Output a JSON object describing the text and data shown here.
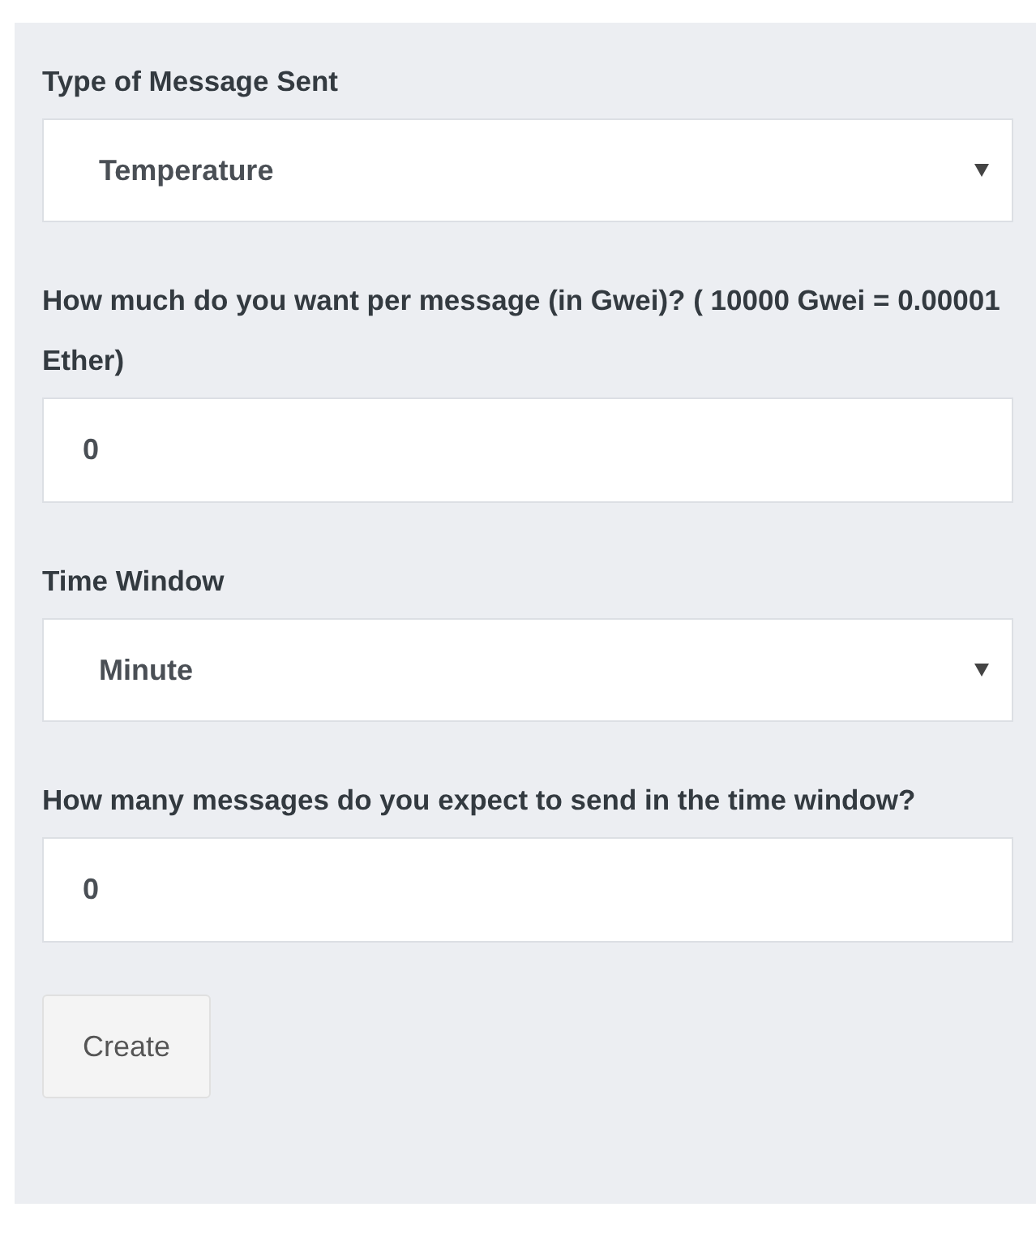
{
  "fields": [
    {
      "kind": "select",
      "label": "Type of Message Sent",
      "value": "Temperature"
    },
    {
      "kind": "number",
      "label": "How much do you want per message (in Gwei)? ( 10000 Gwei = 0.00001 Ether)",
      "value": "0"
    },
    {
      "kind": "select",
      "label": "Time Window",
      "value": "Minute"
    },
    {
      "kind": "number",
      "label": "How many messages do you expect to send in the time window?",
      "value": "0"
    }
  ],
  "button": "Create"
}
